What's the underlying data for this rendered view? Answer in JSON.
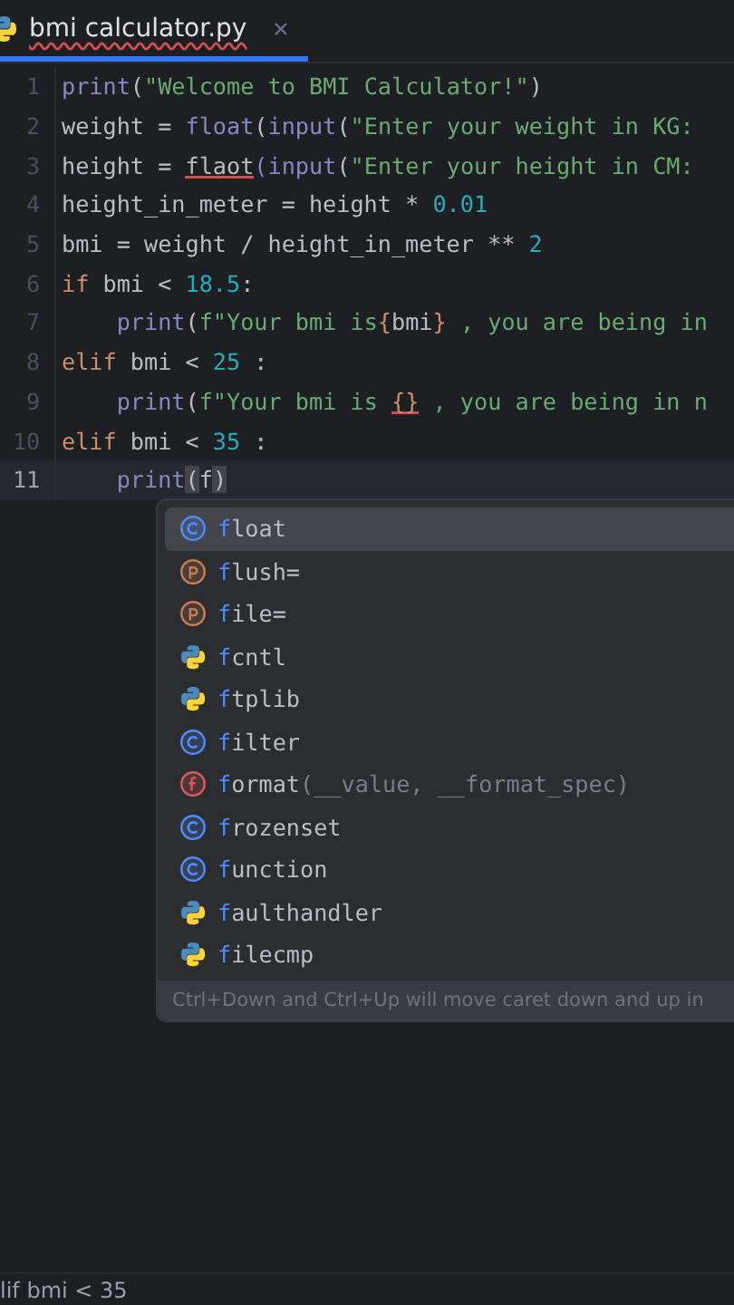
{
  "tab": {
    "title": "bmi calculator.py",
    "selected": true,
    "error": true
  },
  "code": [
    {
      "number": "1",
      "indented": false,
      "current": false,
      "tokens": [
        {
          "kind": "builtin",
          "text": "print"
        },
        {
          "kind": "plain",
          "text": "("
        },
        {
          "kind": "str",
          "text": "\"Welcome to BMI Calculator!\""
        },
        {
          "kind": "plain",
          "text": ")"
        }
      ]
    },
    {
      "number": "2",
      "indented": false,
      "current": false,
      "tokens": [
        {
          "kind": "plain",
          "text": "weight = "
        },
        {
          "kind": "builtin",
          "text": "float"
        },
        {
          "kind": "plain",
          "text": "("
        },
        {
          "kind": "builtin",
          "text": "input"
        },
        {
          "kind": "plain",
          "text": "("
        },
        {
          "kind": "str",
          "text": "\"Enter your weight in KG:"
        }
      ]
    },
    {
      "number": "3",
      "indented": false,
      "current": false,
      "tokens": [
        {
          "kind": "plain",
          "text": "height = "
        },
        {
          "kind": "plain",
          "text": "flaot",
          "error": true
        },
        {
          "kind": "builtin",
          "text": "("
        },
        {
          "kind": "builtin",
          "text": "input"
        },
        {
          "kind": "plain",
          "text": "("
        },
        {
          "kind": "str",
          "text": "\"Enter your height in CM:"
        }
      ]
    },
    {
      "number": "4",
      "indented": false,
      "current": false,
      "tokens": [
        {
          "kind": "plain",
          "text": "height_in_meter = height * "
        },
        {
          "kind": "num",
          "text": "0.01"
        }
      ]
    },
    {
      "number": "5",
      "indented": false,
      "current": false,
      "tokens": [
        {
          "kind": "plain",
          "text": "bmi = weight / height_in_meter ** "
        },
        {
          "kind": "num",
          "text": "2"
        }
      ]
    },
    {
      "number": "6",
      "indented": false,
      "current": false,
      "tokens": [
        {
          "kind": "kw",
          "text": "if"
        },
        {
          "kind": "plain",
          "text": " bmi < "
        },
        {
          "kind": "num",
          "text": "18.5"
        },
        {
          "kind": "plain",
          "text": ":"
        }
      ]
    },
    {
      "number": "7",
      "indented": true,
      "current": false,
      "tokens": [
        {
          "kind": "builtin",
          "text": "print"
        },
        {
          "kind": "plain",
          "text": "("
        },
        {
          "kind": "str",
          "text": "f\"Your bmi is"
        },
        {
          "kind": "brace",
          "text": "{"
        },
        {
          "kind": "plain",
          "text": "bmi"
        },
        {
          "kind": "brace",
          "text": "}"
        },
        {
          "kind": "str",
          "text": " , you are being in"
        }
      ]
    },
    {
      "number": "8",
      "indented": false,
      "current": false,
      "tokens": [
        {
          "kind": "kw",
          "text": "elif"
        },
        {
          "kind": "plain",
          "text": " bmi < "
        },
        {
          "kind": "num",
          "text": "25"
        },
        {
          "kind": "plain",
          "text": " :"
        }
      ]
    },
    {
      "number": "9",
      "indented": true,
      "current": false,
      "tokens": [
        {
          "kind": "builtin",
          "text": "print"
        },
        {
          "kind": "plain",
          "text": "("
        },
        {
          "kind": "str",
          "text": "f\"Your bmi is "
        },
        {
          "kind": "brace",
          "text": "{}",
          "error": true
        },
        {
          "kind": "str",
          "text": " , you are being in n"
        }
      ]
    },
    {
      "number": "10",
      "indented": false,
      "current": false,
      "tokens": [
        {
          "kind": "kw",
          "text": "elif"
        },
        {
          "kind": "plain",
          "text": " bmi < "
        },
        {
          "kind": "num",
          "text": "35"
        },
        {
          "kind": "plain",
          "text": " :"
        }
      ]
    },
    {
      "number": "11",
      "indented": true,
      "current": true,
      "tokens": [
        {
          "kind": "builtin",
          "text": "print"
        },
        {
          "kind": "match",
          "text": "("
        },
        {
          "kind": "plain",
          "text": "f"
        },
        {
          "kind": "match",
          "text": ")"
        }
      ]
    }
  ],
  "completion": {
    "items": [
      {
        "kind": "class",
        "label": "**f**loat",
        "selected": true
      },
      {
        "kind": "parameter",
        "label": "**f**lush=",
        "selected": false
      },
      {
        "kind": "parameter",
        "label": "**f**ile=",
        "selected": false
      },
      {
        "kind": "module",
        "label": "**f**cntl",
        "selected": false
      },
      {
        "kind": "module",
        "label": "**f**tplib",
        "selected": false
      },
      {
        "kind": "class",
        "label": "**f**ilter",
        "selected": false
      },
      {
        "kind": "function",
        "label": "**f**ormat",
        "detail": "(__value, __format_spec)",
        "selected": false
      },
      {
        "kind": "class",
        "label": "**f**rozenset",
        "selected": false
      },
      {
        "kind": "class",
        "label": "**f**unction",
        "selected": false
      },
      {
        "kind": "module",
        "label": "**f**aulthandler",
        "selected": false
      },
      {
        "kind": "module",
        "label": "**f**ilecmp",
        "selected": false
      }
    ],
    "hint": "Ctrl+Down and Ctrl+Up will move caret down and up in"
  },
  "breadcrumb": "lif bmi < 35"
}
